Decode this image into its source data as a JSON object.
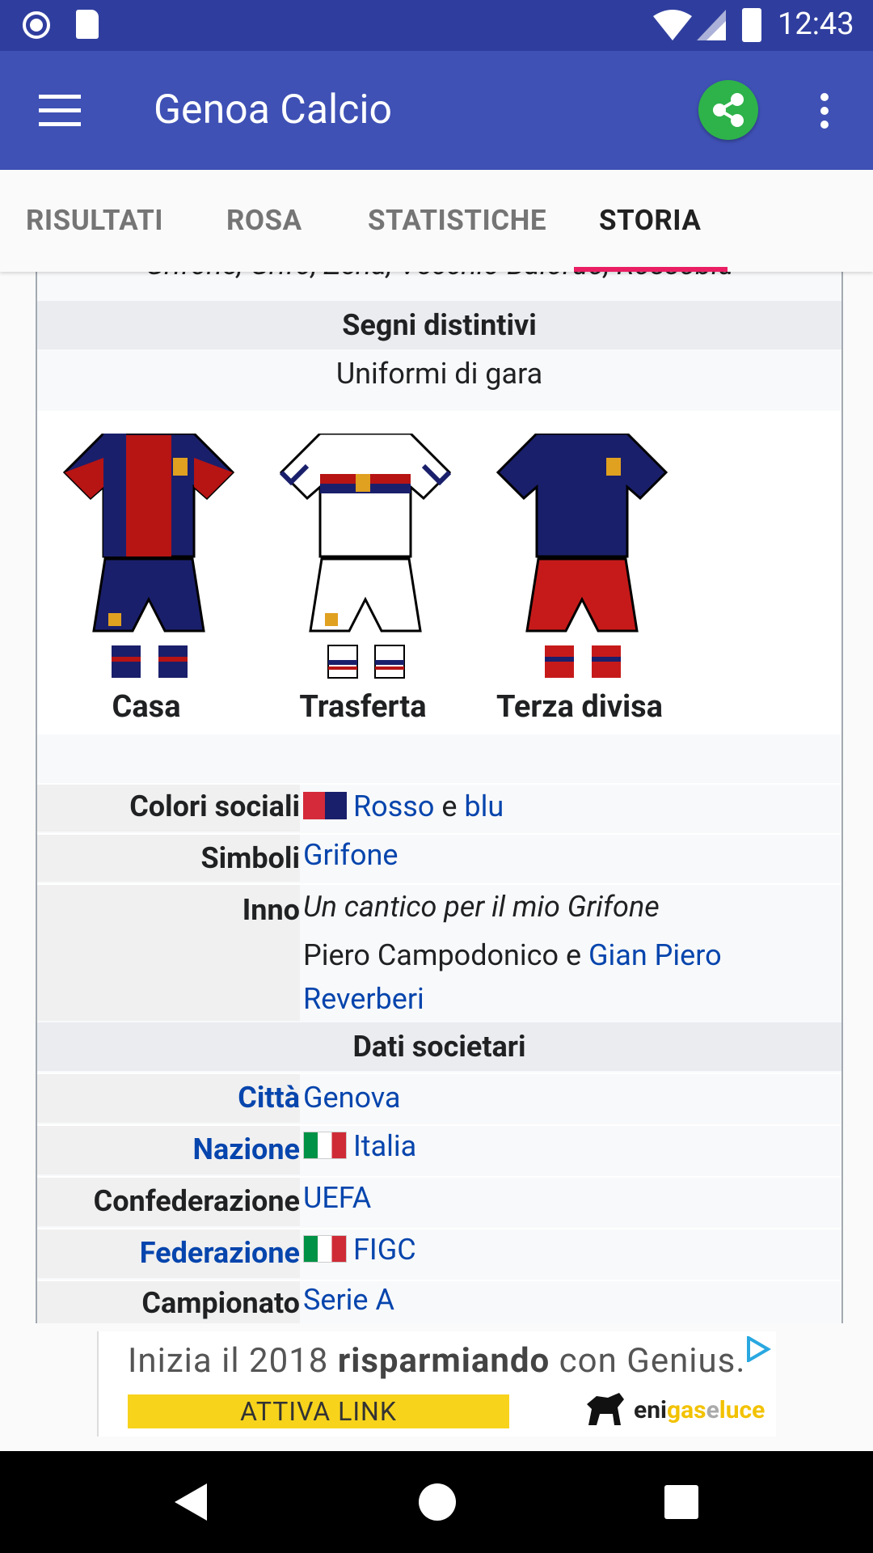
{
  "status_bar": {
    "time": "12:43"
  },
  "app_bar": {
    "title": "Genoa Calcio",
    "menu_icon": "hamburger-menu-icon",
    "share_icon": "share-icon",
    "overflow_icon": "more-vert-icon"
  },
  "tabs": [
    {
      "label": "RISULTATI",
      "active": false
    },
    {
      "label": "ROSA",
      "active": false
    },
    {
      "label": "STATISTICHE",
      "active": false
    },
    {
      "label": "STORIA",
      "active": true
    }
  ],
  "infobox": {
    "nicknames_partial": "Grifone, Grifo, Zena, Vecchio Balordo, Rossoblù",
    "section_signs": "Segni distintivi",
    "uniforms_caption": "Uniformi di gara",
    "kits": [
      {
        "label": "Casa"
      },
      {
        "label": "Trasferta"
      },
      {
        "label": "Terza divisa"
      }
    ],
    "colori_label": "Colori sociali",
    "colori_link1": "Rosso",
    "colori_and": "e",
    "colori_link2": "blu",
    "simboli_label": "Simboli",
    "simboli_value": "Grifone",
    "inno_label": "Inno",
    "inno_title": "Un cantico per il mio Grifone",
    "inno_authors_plain": "Piero Campodonico e",
    "inno_authors_link1": "Gian Piero",
    "inno_authors_link2": "Reverberi",
    "section_company": "Dati societari",
    "citta_label": "Città",
    "citta_value": "Genova",
    "nazione_label": "Nazione",
    "nazione_value": "Italia",
    "confed_label": "Confederazione",
    "confed_value": "UEFA",
    "federazione_label": "Federazione",
    "federazione_value": "FIGC",
    "campionato_label": "Campionato",
    "campionato_value": "Serie A"
  },
  "ad": {
    "headline_pre": "Inizia il 2018",
    "headline_bold": "risparmiando",
    "headline_post": "con Genius.",
    "cta": "ATTIVA LINK",
    "brand_a": "eni",
    "brand_b": "gas",
    "brand_c": "e",
    "brand_d": "luce"
  },
  "colors": {
    "primary": "#3f51b5",
    "status": "#2f3e9e",
    "accent": "#e91e63",
    "link": "#0645ad",
    "share_fab": "#2eb24a"
  }
}
